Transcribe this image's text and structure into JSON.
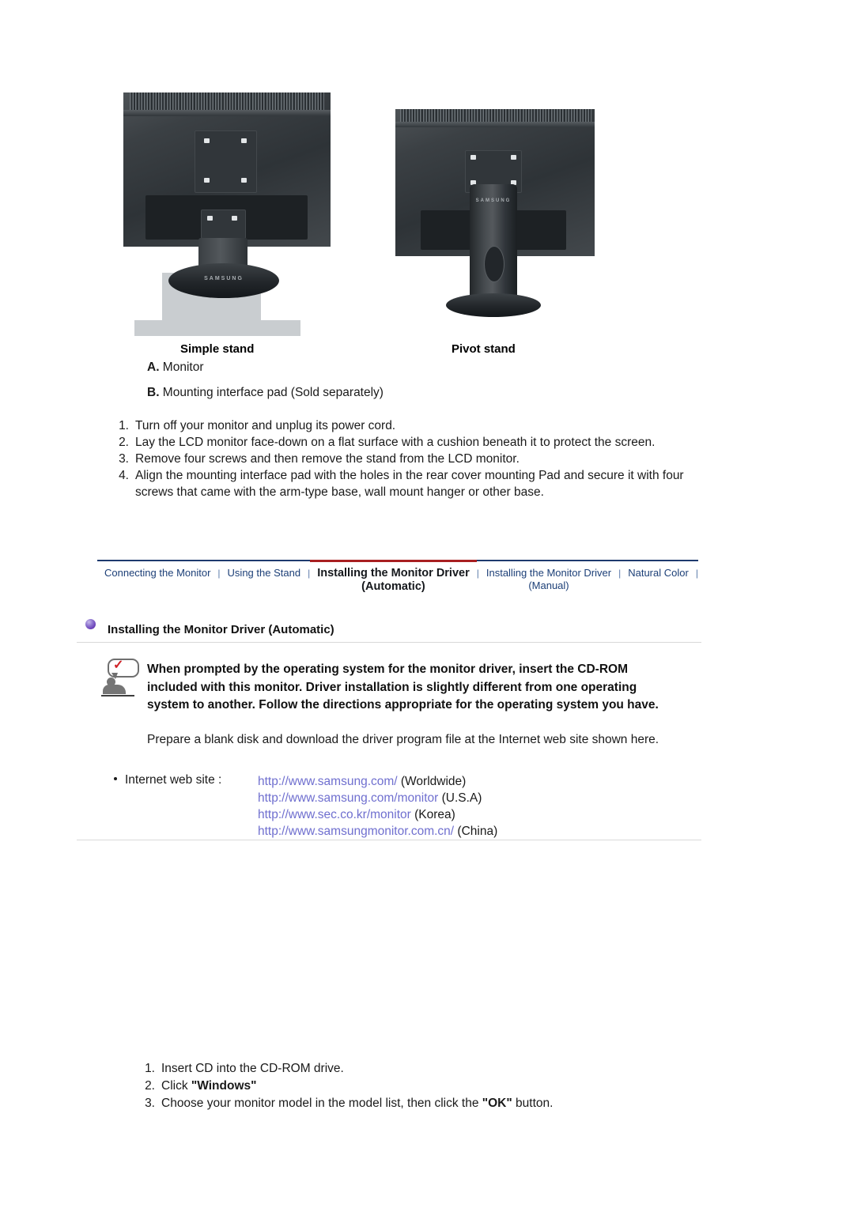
{
  "figures": [
    {
      "id": "simple-stand",
      "caption": "Simple stand",
      "wordmark": "SAMSUNG"
    },
    {
      "id": "pivot-stand",
      "caption": "Pivot stand",
      "wordmark": "SAMSUNG"
    }
  ],
  "parts": {
    "a_label": "A.",
    "a_text": " Monitor",
    "b_label": "B.",
    "b_text": " Mounting interface pad (Sold separately)"
  },
  "steps_top": [
    {
      "num": "1.",
      "text": "Turn off your monitor and unplug its power cord."
    },
    {
      "num": "2.",
      "text": "Lay the LCD monitor face-down on a flat surface with a cushion beneath it to protect the screen."
    },
    {
      "num": "3.",
      "text": "Remove four screws and then remove the stand from the LCD monitor."
    },
    {
      "num": "4.",
      "text": "Align the mounting interface pad with the holes in the rear cover mounting Pad and secure it with four screws that came with the arm-type base, wall mount hanger or other base."
    }
  ],
  "nav": {
    "separator": "|",
    "tabs": [
      {
        "label": "Connecting  the Monitor",
        "active": false
      },
      {
        "label": "Using the Stand",
        "active": false
      },
      {
        "label": "Installing the Monitor Driver\n(Automatic)",
        "active": true
      },
      {
        "label": "Installing the Monitor Driver\n(Manual)",
        "active": false
      },
      {
        "label": "Natural Color",
        "active": false
      }
    ],
    "line_color": "#1e3a6e",
    "active_underline_color": "#a81f21",
    "link_color": "#1c3f77"
  },
  "section": {
    "heading": "Installing the Monitor Driver (Automatic)",
    "bullet_color": "#6a3fb8"
  },
  "note": {
    "icon": "person-with-checkmark-speech-bubble",
    "check_color": "#cf2126",
    "text": "When prompted by the operating system for the monitor driver, insert the CD-ROM included with this monitor. Driver installation is slightly different from one operating system to another. Follow the directions appropriate for the operating system you have."
  },
  "prepare_text": "Prepare a blank disk and download the driver program file at the Internet web site shown here.",
  "web": {
    "label": "Internet web site :",
    "link_color": "#6f6fcf",
    "urls": [
      {
        "url": "http://www.samsung.com/",
        "region": " (Worldwide)"
      },
      {
        "url": "http://www.samsung.com/monitor",
        "region": " (U.S.A)"
      },
      {
        "url": "http://www.sec.co.kr/monitor",
        "region": " (Korea)"
      },
      {
        "url": "http://www.samsungmonitor.com.cn/",
        "region": " (China)"
      }
    ]
  },
  "steps_bottom": [
    {
      "num": "1.",
      "pre": "Insert CD into the CD-ROM drive.",
      "strong": "",
      "post": ""
    },
    {
      "num": "2.",
      "pre": "Click ",
      "strong": "\"Windows\"",
      "post": ""
    },
    {
      "num": "3.",
      "pre": "Choose your monitor model in the model list, then click the ",
      "strong": "\"OK\"",
      "post": " button."
    }
  ]
}
